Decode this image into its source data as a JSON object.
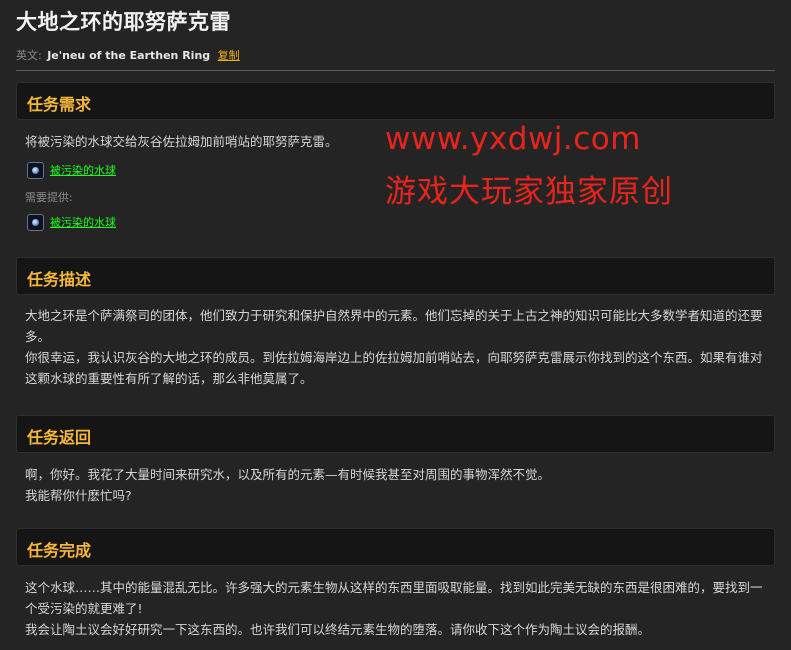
{
  "quest": {
    "title": "大地之环的耶努萨克雷",
    "en_label": "英文:",
    "en_name": "Je'neu of the Earthen Ring",
    "copy_label": "复制"
  },
  "sections": {
    "requirements": {
      "header": "任务需求",
      "text": "将被污染的水球交给灰谷佐拉姆加前哨站的耶努萨克雷。",
      "item_link": "被污染的水球",
      "provided_label": "需要提供:",
      "provided_item_link": "被污染的水球",
      "item_icon": "tainted-water-orb-icon"
    },
    "description": {
      "header": "任务描述",
      "line1": "大地之环是个萨满祭司的团体，他们致力于研究和保护自然界中的元素。他们忘掉的关于上古之神的知识可能比大多数学者知道的还要多。",
      "line2": "你很幸运，我认识灰谷的大地之环的成员。到佐拉姆海岸边上的佐拉姆加前哨站去，向耶努萨克雷展示你找到的这个东西。如果有谁对这颗水球的重要性有所了解的话，那么非他莫属了。"
    },
    "return": {
      "header": "任务返回",
      "line1": "啊，你好。我花了大量时间来研究水，以及所有的元素—有时候我甚至对周围的事物浑然不觉。",
      "line2": "我能帮你什麽忙吗?"
    },
    "complete": {
      "header": "任务完成",
      "line1": "这个水球……其中的能量混乱无比。许多强大的元素生物从这样的东西里面吸取能量。找到如此完美无缺的东西是很困难的，要找到一个受污染的就更难了!",
      "line2": "我会让陶土议会好好研究一下这东西的。也许我们可以终结元素生物的堕落。请你收下这个作为陶土议会的报酬。"
    }
  },
  "watermark": {
    "line1": "www.yxdwj.com",
    "line2": "游戏大玩家独家原创"
  },
  "colors": {
    "background": "#242424",
    "header_bg": "#151515",
    "header_text": "#f5b83a",
    "item_link": "#1eff1e",
    "copy_link": "#f0b020",
    "watermark": "#e8241c"
  }
}
